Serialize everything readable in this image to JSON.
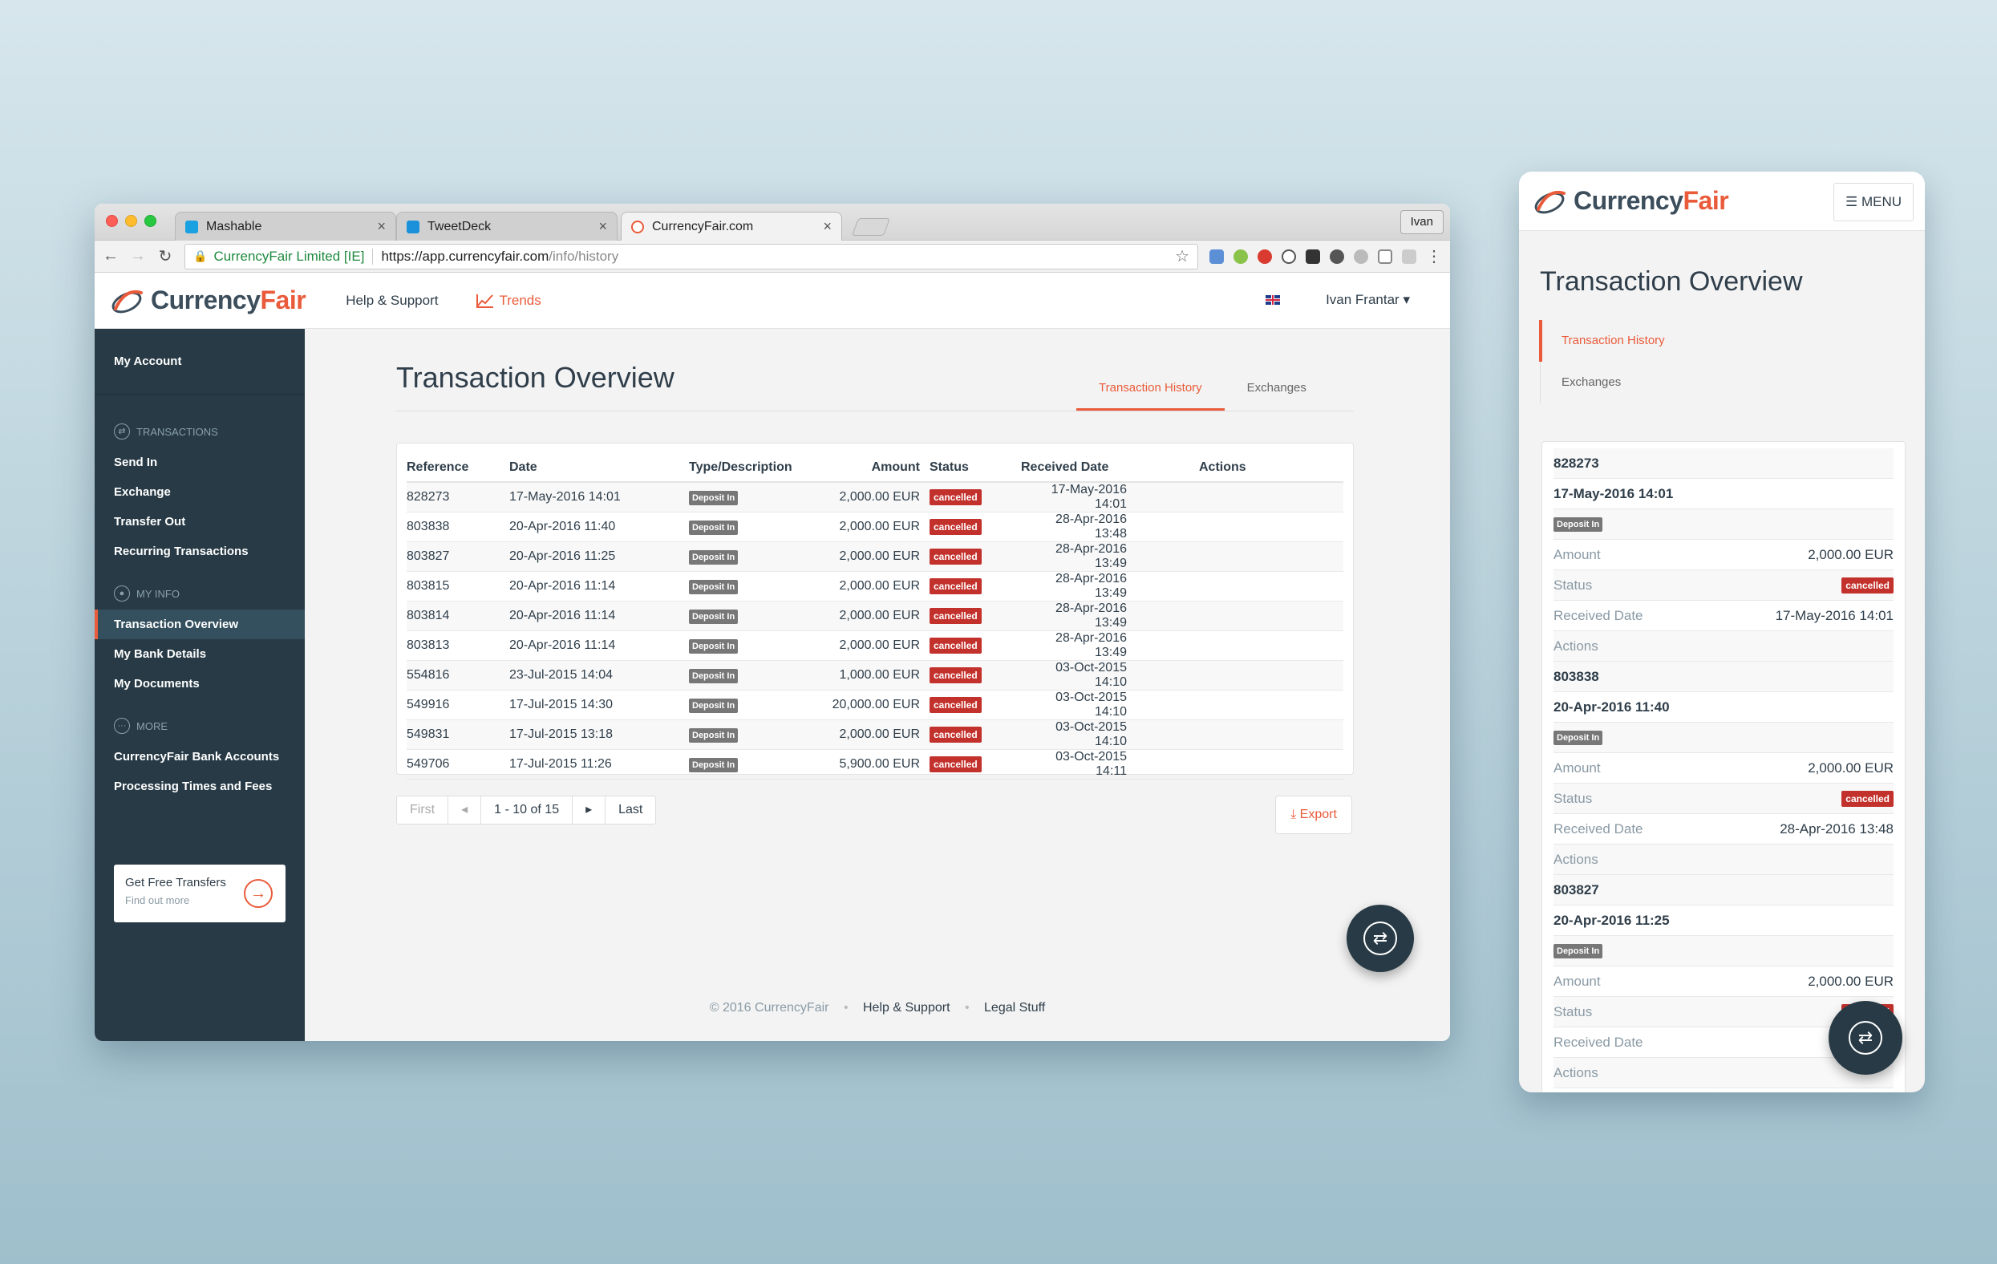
{
  "browser": {
    "tabs": [
      {
        "label": "Mashable",
        "favicon_color": "#1aa1e1"
      },
      {
        "label": "TweetDeck",
        "favicon_color": "#1a91da"
      },
      {
        "label": "CurrencyFair.com",
        "favicon_color": "#e95b3a"
      }
    ],
    "profile": "Ivan",
    "secure_name": "CurrencyFair Limited [IE]",
    "url_host": "https://app.currencyfair.com",
    "url_path": "/info/history"
  },
  "header": {
    "logo_part1": "Currency",
    "logo_part2": "Fair",
    "help_link": "Help & Support",
    "trends_link": "Trends",
    "user_name": "Ivan Frantar"
  },
  "sidebar": {
    "my_account": "My Account",
    "sections": [
      {
        "title": "TRANSACTIONS",
        "items": [
          "Send In",
          "Exchange",
          "Transfer Out",
          "Recurring Transactions"
        ]
      },
      {
        "title": "MY INFO",
        "items": [
          "Transaction Overview",
          "My Bank Details",
          "My Documents"
        ]
      },
      {
        "title": "MORE",
        "items": [
          "CurrencyFair Bank Accounts",
          "Processing Times and Fees"
        ]
      }
    ],
    "promo_title": "Get Free Transfers",
    "promo_sub": "Find out more"
  },
  "main": {
    "title": "Transaction Overview",
    "tabs": [
      "Transaction History",
      "Exchanges"
    ],
    "columns": [
      "Reference",
      "Date",
      "Type/Description",
      "Amount",
      "Status",
      "Received Date",
      "Actions"
    ],
    "rows": [
      {
        "ref": "828273",
        "date": "17-May-2016 14:01",
        "type": "Deposit In",
        "amount": "2,000.00 EUR",
        "status": "cancelled",
        "received": "17-May-2016 14:01"
      },
      {
        "ref": "803838",
        "date": "20-Apr-2016 11:40",
        "type": "Deposit In",
        "amount": "2,000.00 EUR",
        "status": "cancelled",
        "received": "28-Apr-2016 13:48"
      },
      {
        "ref": "803827",
        "date": "20-Apr-2016 11:25",
        "type": "Deposit In",
        "amount": "2,000.00 EUR",
        "status": "cancelled",
        "received": "28-Apr-2016 13:49"
      },
      {
        "ref": "803815",
        "date": "20-Apr-2016 11:14",
        "type": "Deposit In",
        "amount": "2,000.00 EUR",
        "status": "cancelled",
        "received": "28-Apr-2016 13:49"
      },
      {
        "ref": "803814",
        "date": "20-Apr-2016 11:14",
        "type": "Deposit In",
        "amount": "2,000.00 EUR",
        "status": "cancelled",
        "received": "28-Apr-2016 13:49"
      },
      {
        "ref": "803813",
        "date": "20-Apr-2016 11:14",
        "type": "Deposit In",
        "amount": "2,000.00 EUR",
        "status": "cancelled",
        "received": "28-Apr-2016 13:49"
      },
      {
        "ref": "554816",
        "date": "23-Jul-2015 14:04",
        "type": "Deposit In",
        "amount": "1,000.00 EUR",
        "status": "cancelled",
        "received": "03-Oct-2015 14:10"
      },
      {
        "ref": "549916",
        "date": "17-Jul-2015 14:30",
        "type": "Deposit In",
        "amount": "20,000.00 EUR",
        "status": "cancelled",
        "received": "03-Oct-2015 14:10"
      },
      {
        "ref": "549831",
        "date": "17-Jul-2015 13:18",
        "type": "Deposit In",
        "amount": "2,000.00 EUR",
        "status": "cancelled",
        "received": "03-Oct-2015 14:10"
      },
      {
        "ref": "549706",
        "date": "17-Jul-2015 11:26",
        "type": "Deposit In",
        "amount": "5,900.00 EUR",
        "status": "cancelled",
        "received": "03-Oct-2015 14:11"
      }
    ],
    "pager": {
      "first": "First",
      "range": "1 - 10 of 15",
      "last": "Last"
    },
    "export": "Export",
    "footer": {
      "copyright": "© 2016 CurrencyFair",
      "help": "Help & Support",
      "legal": "Legal Stuff"
    }
  },
  "mobile": {
    "menu": "MENU",
    "title": "Transaction Overview",
    "tabs": [
      "Transaction History",
      "Exchanges"
    ],
    "labels": {
      "amount": "Amount",
      "status": "Status",
      "received": "Received Date",
      "actions": "Actions"
    },
    "third_received_visible": "28-Apr-"
  },
  "colors": {
    "accent": "#e95b3a",
    "sidebar": "#273a45",
    "cancelled": "#c3312c",
    "deposit": "#777777"
  }
}
